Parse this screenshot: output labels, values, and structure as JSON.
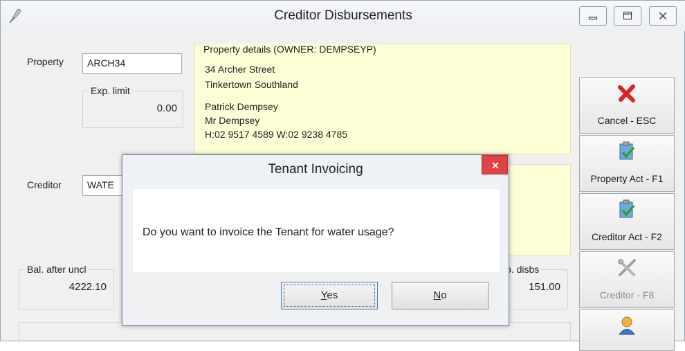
{
  "window": {
    "title": "Creditor Disbursements"
  },
  "form": {
    "property_label": "Property",
    "property_value": "ARCH34",
    "exp_limit_label": "Exp. limit",
    "exp_limit_value": "0.00",
    "creditor_label": "Creditor",
    "creditor_value": "WATE",
    "bal_after_label": "Bal. after uncl",
    "bal_after_value": "4222.10",
    "exp_disbs_label": "p. disbs",
    "exp_disbs_value": "151.00"
  },
  "property_details": {
    "caption": "Property details  (OWNER:  DEMPSEYP)",
    "address_line1": "34 Archer Street",
    "address_line2": "Tinkertown  Southland",
    "owner_name": "Patrick Dempsey",
    "salutation": "Mr Dempsey",
    "phones": "H:02 9517 4589 W:02 9238 4785"
  },
  "side_buttons": [
    {
      "label": "Cancel - ESC",
      "icon": "red-x-icon",
      "enabled": true
    },
    {
      "label": "Property Act - F1",
      "icon": "clipboard-check-icon",
      "enabled": true
    },
    {
      "label": "Creditor Act - F2",
      "icon": "clipboard-check-icon",
      "enabled": true
    },
    {
      "label": "Creditor - F8",
      "icon": "tools-icon",
      "enabled": false
    },
    {
      "label": "",
      "icon": "person-icon",
      "enabled": true
    }
  ],
  "dialog": {
    "title": "Tenant Invoicing",
    "message": "Do you want to invoice the Tenant for water usage?",
    "yes_mnemonic": "Y",
    "yes_rest": "es",
    "no_mnemonic": "N",
    "no_rest": "o"
  },
  "colors": {
    "info_panel": "#fefed6",
    "dialog_close": "#e04343",
    "focus_border": "#3d7bd0"
  }
}
